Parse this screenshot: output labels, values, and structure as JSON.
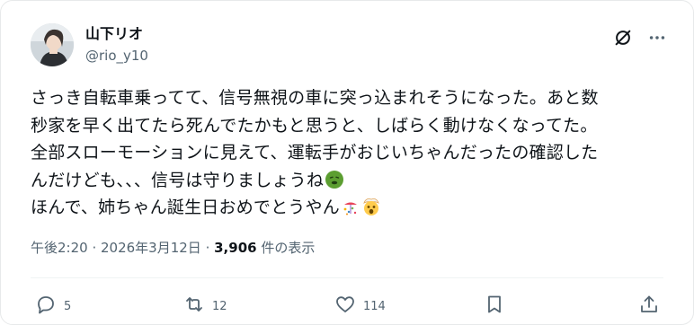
{
  "author": {
    "display_name": "山下リオ",
    "handle": "@rio_y10"
  },
  "tweet": {
    "lines": [
      "さっき自転車乗ってて、信号無視の車に突っ込まれそうになった。あと数",
      "秒家を早く出てたら死んでたかもと思うと、しばらく動けなくなってた。",
      "全部スローモーションに見えて、運転手がおじいちゃんだったの確認した",
      "んだけども、、、信号は守りましょうね",
      "ほんで、姉ちゃん誕生日おめでとうやん"
    ],
    "emoji": [
      "nauseated-face",
      "confetti-ball",
      "exploding-head"
    ]
  },
  "meta": {
    "time": "午後2:20",
    "sep1": " · ",
    "date": "2026年3月12日",
    "sep2": " · ",
    "views": "3,906",
    "views_label": " 件の表示"
  },
  "actions": {
    "reply_count": "5",
    "retweet_count": "12",
    "like_count": "114"
  },
  "colors": {
    "text": "#0f1419",
    "secondary": "#536471",
    "border": "#e7e9ea"
  }
}
